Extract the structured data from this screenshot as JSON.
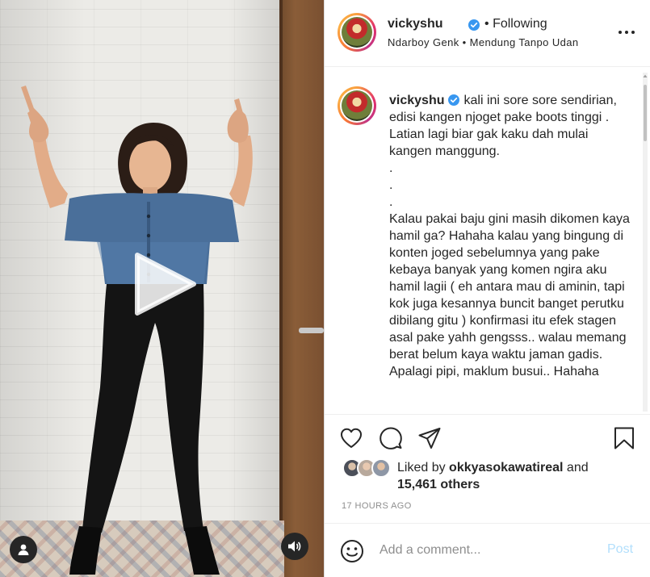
{
  "post": {
    "username": "vickyshu",
    "follow_separator": "•",
    "follow_status": "Following",
    "location": "Ndarboy Genk • Mendung Tanpo Udan",
    "caption": "kali ini sore sore sendirian, edisi kangen njoget pake boots tinggi . Latian lagi biar gak kaku dah mulai kangen manggung.\n.\n.\n.\nKalau pakai baju gini masih dikomen kaya hamil ga? Hahaha kalau yang bingung di konten joged sebelumnya yang pake kebaya banyak yang komen ngira aku hamil lagii ( eh antara mau di aminin, tapi kok juga kesannya buncit banget perutku dibilang gitu ) konfirmasi itu efek stagen asal pake yahh gengsss.. walau memang berat belum kaya waktu jaman gadis. Apalagi pipi, maklum busui.. Hahaha",
    "likes": {
      "prefix": "Liked by",
      "liked_by": "okkyasokawatireal",
      "joiner": "and",
      "count": "15,461 others"
    },
    "timestamp": "17 HOURS AGO"
  },
  "comment": {
    "placeholder": "Add a comment...",
    "post_label": "Post"
  },
  "icons": {
    "media": [
      "play-icon",
      "user-icon",
      "sound-icon"
    ],
    "header": [
      "verified-icon",
      "more-options-icon"
    ],
    "actions": [
      "heart-icon",
      "comment-icon",
      "share-icon",
      "bookmark-icon"
    ],
    "comment": [
      "emoji-icon"
    ]
  },
  "colors": {
    "verified": "#3897f0",
    "post_disabled": "#b2dffc",
    "muted_text": "#8e8e8e",
    "text": "#262626"
  }
}
